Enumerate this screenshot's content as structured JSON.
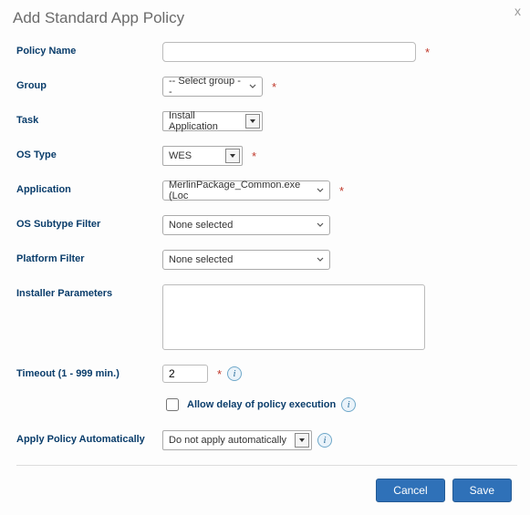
{
  "title": "Add Standard App Policy",
  "close_glyph": "x",
  "required_marker": "*",
  "info_glyph": "i",
  "labels": {
    "policy_name": "Policy Name",
    "group": "Group",
    "task": "Task",
    "os_type": "OS Type",
    "application": "Application",
    "os_subtype_filter": "OS Subtype Filter",
    "platform_filter": "Platform Filter",
    "installer_parameters": "Installer Parameters",
    "timeout": "Timeout (1 - 999 min.)",
    "allow_delay": "Allow delay of policy execution",
    "apply_auto": "Apply Policy Automatically"
  },
  "values": {
    "policy_name": "",
    "group": "-- Select group --",
    "task": "Install Application",
    "os_type": "WES",
    "application": "MerlinPackage_Common.exe (Loc",
    "os_subtype_filter": "None selected",
    "platform_filter": "None selected",
    "installer_parameters": "",
    "timeout": "2",
    "allow_delay_checked": false,
    "apply_auto": "Do not apply automatically"
  },
  "buttons": {
    "cancel": "Cancel",
    "save": "Save"
  }
}
